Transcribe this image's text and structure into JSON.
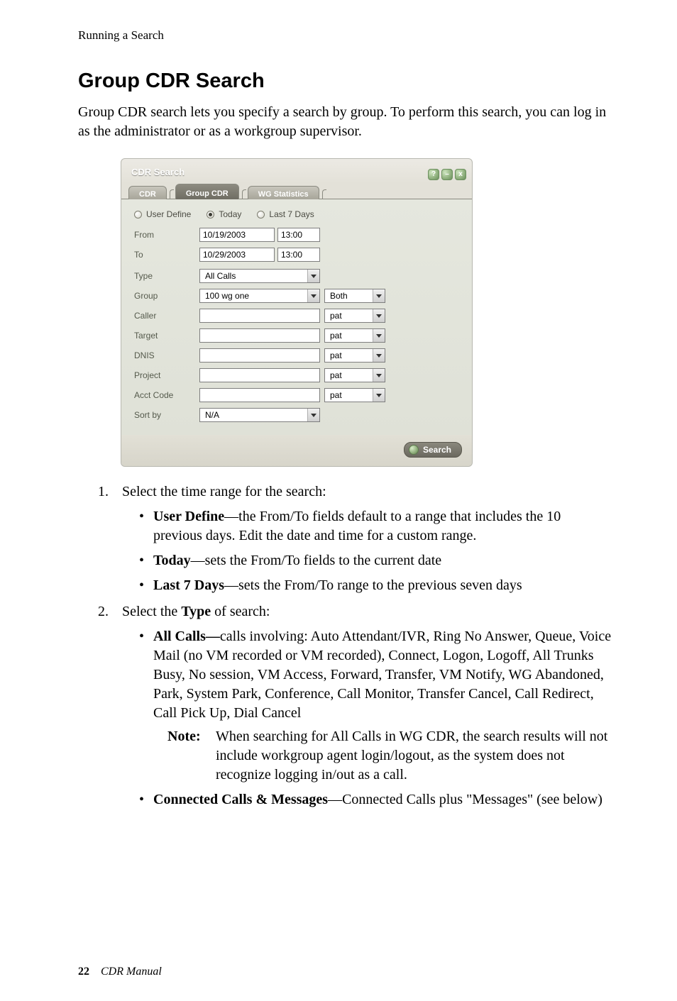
{
  "running_head": "Running a Search",
  "section_title": "Group CDR Search",
  "intro": "Group CDR search lets you specify a search by group. To perform this search, you can log in as the administrator or as a workgroup supervisor.",
  "widget": {
    "title": "CDR Search",
    "win_buttons": {
      "help": "?",
      "minimize": "–",
      "close": "x"
    },
    "tabs": {
      "cdr": "CDR",
      "group_cdr": "Group CDR",
      "wg_stats": "WG Statistics"
    },
    "radios": {
      "user_define": "User Define",
      "today": "Today",
      "last7": "Last 7 Days"
    },
    "labels": {
      "from": "From",
      "to": "To",
      "type": "Type",
      "group": "Group",
      "caller": "Caller",
      "target": "Target",
      "dnis": "DNIS",
      "project": "Project",
      "acct_code": "Acct Code",
      "sort_by": "Sort by"
    },
    "values": {
      "from_date": "10/19/2003",
      "from_time": "13:00",
      "to_date": "10/29/2003",
      "to_time": "13:00",
      "type": "All Calls",
      "group": "100  wg one",
      "group_side": "Both",
      "caller": "",
      "caller_side": "pat",
      "target": "",
      "target_side": "pat",
      "dnis": "",
      "dnis_side": "pat",
      "project": "",
      "project_side": "pat",
      "acct_code": "",
      "acct_side": "pat",
      "sort_by": "N/A"
    },
    "search_button": "Search"
  },
  "steps": {
    "s1": "Select the time range for the search:",
    "s1_items": {
      "ud_bold": "User Define",
      "ud_rest": "—the From/To fields default to a range that includes the 10 previous days. Edit the date and time for a custom range.",
      "today_bold": "Today",
      "today_rest": "—sets the From/To fields to the current date",
      "l7_bold": "Last 7 Days",
      "l7_rest": "—sets the From/To range to the previous seven days"
    },
    "s2_pre": "Select the ",
    "s2_bold": "Type",
    "s2_post": " of search:",
    "s2_items": {
      "ac_bold": "All Calls—",
      "ac_rest": "calls involving: Auto Attendant/IVR, Ring No Answer, Queue, Voice Mail (no VM recorded or VM recorded), Connect, Logon, Logoff, All Trunks Busy, No session, VM Access, Forward, Transfer, VM Notify, WG Abandoned, Park, System Park, Conference, Call Monitor, Transfer Cancel, Call Redirect, Call Pick Up, Dial Cancel",
      "note_label": "Note:",
      "note_text": "When searching for All Calls in WG CDR, the search results will not include workgroup agent login/logout, as the system does not recognize logging in/out as a call.",
      "ccm_bold": "Connected Calls & Messages",
      "ccm_rest": "—Connected Calls plus \"Messages\" (see below)"
    }
  },
  "footer": {
    "page": "22",
    "doc": "CDR Manual"
  }
}
